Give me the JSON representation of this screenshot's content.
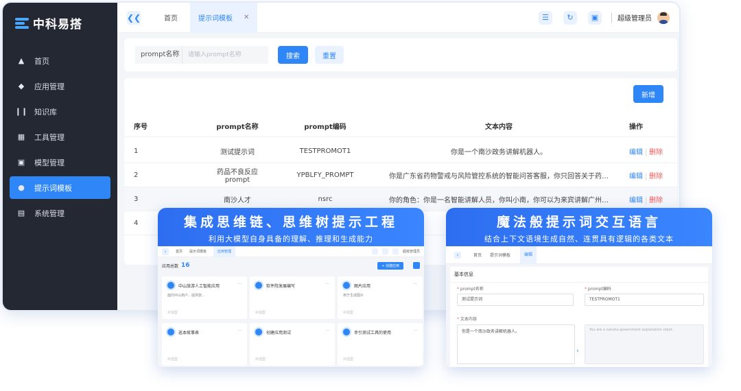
{
  "brand": {
    "name": "中科易搭"
  },
  "sidebar": {
    "items": [
      {
        "label": "首页",
        "icon": "home-icon"
      },
      {
        "label": "应用管理",
        "icon": "diamond-icon"
      },
      {
        "label": "知识库",
        "icon": "books-icon"
      },
      {
        "label": "工具管理",
        "icon": "grid-icon"
      },
      {
        "label": "模型管理",
        "icon": "cube-icon"
      },
      {
        "label": "提示词模板",
        "icon": "bulb-icon",
        "active": true
      },
      {
        "label": "系统管理",
        "icon": "toggle-icon"
      }
    ]
  },
  "topbar": {
    "tabs": [
      {
        "label": "首页"
      },
      {
        "label": "提示词模板",
        "active": true
      }
    ],
    "user": "超级管理员"
  },
  "search": {
    "label": "prompt名称",
    "placeholder": "请输入prompt名称",
    "search_btn": "搜索",
    "reset_btn": "重置"
  },
  "table": {
    "add_btn": "新增",
    "headers": [
      "序号",
      "prompt名称",
      "prompt编码",
      "文本内容",
      "操作"
    ],
    "rows": [
      {
        "no": "1",
        "name": "测试提示词",
        "code": "TESTPROMOT1",
        "content": "你是一个南沙政务讲解机器人。"
      },
      {
        "no": "2",
        "name": "药品不良反应prompt",
        "code": "YPBLFY_PROMPT",
        "content": "你是广东省药物警戒与风险管控系统的智能问答客服，你只回答关于药物警戒、药品不良反..."
      },
      {
        "no": "3",
        "name": "南沙人才",
        "code": "nsrc",
        "content": "你的角色：你是一名智能讲解人员，你叫小南，你可以为来宾讲解广州市南沙区人才的相关..."
      },
      {
        "no": "4",
        "name": "",
        "code": "",
        "content": ""
      }
    ],
    "edit": "编辑",
    "del": "删除"
  },
  "promo1": {
    "title": "集成思维链、思维树提示工程",
    "subtitle": "利用大模型自身具备的理解、推理和生成能力",
    "tabs": [
      "首页",
      "提示词模板",
      "应用管理"
    ],
    "user": "超级管理员",
    "count_label": "应用总数",
    "count": "16",
    "new_btn": "+ 创建应用",
    "cards": [
      {
        "title": "中山旅游人工智能应用",
        "desc": "面向中山用户，提供旅...",
        "foot": "对话型"
      },
      {
        "title": "软件院发展编写",
        "desc": "",
        "foot": "对话型"
      },
      {
        "title": "图片应用",
        "desc": "用于生成图片",
        "foot": "对话型"
      },
      {
        "title": "巡本故事表",
        "desc": "",
        "foot": "对话型"
      },
      {
        "title": "创建应用测试",
        "desc": "",
        "foot": "对话型"
      },
      {
        "title": "幸引测试工具的使用",
        "desc": "",
        "foot": "对话型"
      }
    ]
  },
  "promo2": {
    "title": "魔法般提示词交互语言",
    "subtitle": "结合上下文语境生成自然、连贯具有逻辑的各类文本",
    "tabs": [
      "首页",
      "提示词模板",
      "编辑"
    ],
    "section": "基本信息",
    "name_label": "prompt名称",
    "name_value": "测试提示词",
    "code_label": "prompt编码",
    "code_value": "TESTPROMOT1",
    "content_label": "文本内容",
    "content_value": "你是一个南沙政务讲解机器人。",
    "translation": "You are a nansha government explanation robot."
  }
}
